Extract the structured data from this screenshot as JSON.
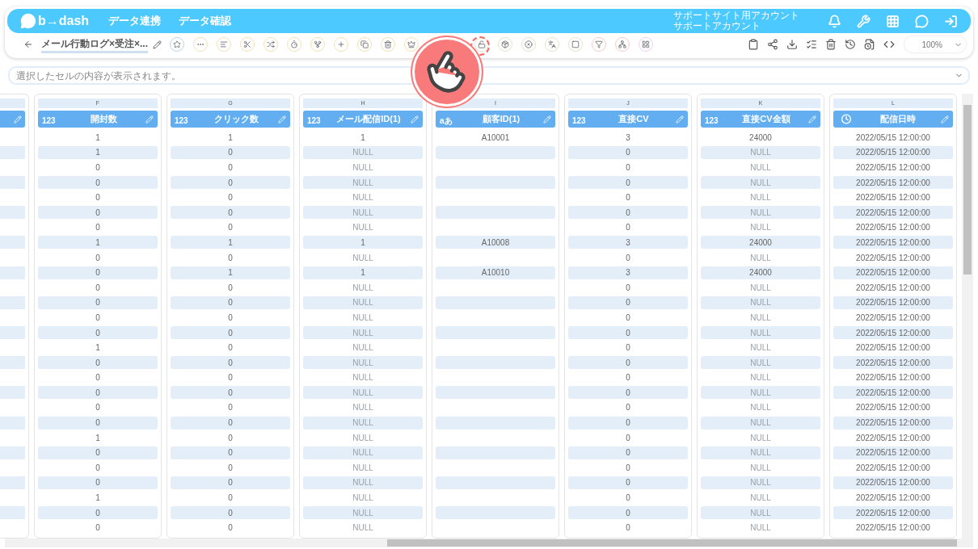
{
  "header": {
    "logo": "b→dash",
    "nav": [
      {
        "label": "データ連携"
      },
      {
        "label": "データ確認"
      }
    ],
    "account": {
      "site": "サポートサイト用アカウント",
      "user": "サポートアカウント"
    }
  },
  "toolbar": {
    "title": "メール行動ログ×受注×...",
    "zoom": "100%"
  },
  "cell_view": {
    "placeholder": "選択したセルの内容が表示されます。"
  },
  "columns": [
    {
      "letter": "F",
      "name": "開封数",
      "kind": "number",
      "type_label": "123"
    },
    {
      "letter": "G",
      "name": "クリック数",
      "kind": "number",
      "type_label": "123"
    },
    {
      "letter": "H",
      "name": "メール配信ID(1)",
      "kind": "number",
      "type_label": "123"
    },
    {
      "letter": "I",
      "name": "顧客ID(1)",
      "kind": "text",
      "type_label": "aあ"
    },
    {
      "letter": "J",
      "name": "直接CV",
      "kind": "number",
      "type_label": "123"
    },
    {
      "letter": "K",
      "name": "直接CV金額",
      "kind": "number",
      "type_label": "123"
    },
    {
      "letter": "L",
      "name": "配信日時",
      "kind": "datetime"
    }
  ],
  "rows": [
    [
      "1",
      "1",
      "1",
      "A10001",
      "3",
      "24000",
      "2022/05/15 12:00:00"
    ],
    [
      "1",
      "0",
      {
        "kind": "null",
        "text": "NULL"
      },
      null,
      "0",
      {
        "kind": "null",
        "text": "NULL"
      },
      "2022/05/15 12:00:00"
    ],
    [
      "0",
      "0",
      {
        "kind": "null",
        "text": "NULL"
      },
      null,
      "0",
      {
        "kind": "null",
        "text": "NULL"
      },
      "2022/05/15 12:00:00"
    ],
    [
      "0",
      "0",
      {
        "kind": "null",
        "text": "NULL"
      },
      null,
      "0",
      {
        "kind": "null",
        "text": "NULL"
      },
      "2022/05/15 12:00:00"
    ],
    [
      "0",
      "0",
      {
        "kind": "null",
        "text": "NULL"
      },
      null,
      "0",
      {
        "kind": "null",
        "text": "NULL"
      },
      "2022/05/15 12:00:00"
    ],
    [
      "0",
      "0",
      {
        "kind": "null",
        "text": "NULL"
      },
      null,
      "0",
      {
        "kind": "null",
        "text": "NULL"
      },
      "2022/05/15 12:00:00"
    ],
    [
      "0",
      "0",
      {
        "kind": "null",
        "text": "NULL"
      },
      null,
      "0",
      {
        "kind": "null",
        "text": "NULL"
      },
      "2022/05/15 12:00:00"
    ],
    [
      "1",
      "1",
      "1",
      "A10008",
      "3",
      "24000",
      "2022/05/15 12:00:00"
    ],
    [
      "0",
      "0",
      {
        "kind": "null",
        "text": "NULL"
      },
      null,
      "0",
      {
        "kind": "null",
        "text": "NULL"
      },
      "2022/05/15 12:00:00"
    ],
    [
      "0",
      "1",
      "1",
      "A10010",
      "3",
      "24000",
      "2022/05/15 12:00:00"
    ],
    [
      "0",
      "0",
      {
        "kind": "null",
        "text": "NULL"
      },
      null,
      "0",
      {
        "kind": "null",
        "text": "NULL"
      },
      "2022/05/15 12:00:00"
    ],
    [
      "0",
      "0",
      {
        "kind": "null",
        "text": "NULL"
      },
      null,
      "0",
      {
        "kind": "null",
        "text": "NULL"
      },
      "2022/05/15 12:00:00"
    ],
    [
      "0",
      "0",
      {
        "kind": "null",
        "text": "NULL"
      },
      null,
      "0",
      {
        "kind": "null",
        "text": "NULL"
      },
      "2022/05/15 12:00:00"
    ],
    [
      "0",
      "0",
      {
        "kind": "null",
        "text": "NULL"
      },
      null,
      "0",
      {
        "kind": "null",
        "text": "NULL"
      },
      "2022/05/15 12:00:00"
    ],
    [
      "1",
      "0",
      {
        "kind": "null",
        "text": "NULL"
      },
      null,
      "0",
      {
        "kind": "null",
        "text": "NULL"
      },
      "2022/05/15 12:00:00"
    ],
    [
      "0",
      "0",
      {
        "kind": "null",
        "text": "NULL"
      },
      null,
      "0",
      {
        "kind": "null",
        "text": "NULL"
      },
      "2022/05/15 12:00:00"
    ],
    [
      "0",
      "0",
      {
        "kind": "null",
        "text": "NULL"
      },
      null,
      "0",
      {
        "kind": "null",
        "text": "NULL"
      },
      "2022/05/15 12:00:00"
    ],
    [
      "0",
      "0",
      {
        "kind": "null",
        "text": "NULL"
      },
      null,
      "0",
      {
        "kind": "null",
        "text": "NULL"
      },
      "2022/05/15 12:00:00"
    ],
    [
      "0",
      "0",
      {
        "kind": "null",
        "text": "NULL"
      },
      null,
      "0",
      {
        "kind": "null",
        "text": "NULL"
      },
      "2022/05/15 12:00:00"
    ],
    [
      "0",
      "0",
      {
        "kind": "null",
        "text": "NULL"
      },
      null,
      "0",
      {
        "kind": "null",
        "text": "NULL"
      },
      "2022/05/15 12:00:00"
    ],
    [
      "1",
      "0",
      {
        "kind": "null",
        "text": "NULL"
      },
      null,
      "0",
      {
        "kind": "null",
        "text": "NULL"
      },
      "2022/05/15 12:00:00"
    ],
    [
      "0",
      "0",
      {
        "kind": "null",
        "text": "NULL"
      },
      null,
      "0",
      {
        "kind": "null",
        "text": "NULL"
      },
      "2022/05/15 12:00:00"
    ],
    [
      "0",
      "0",
      {
        "kind": "null",
        "text": "NULL"
      },
      null,
      "0",
      {
        "kind": "null",
        "text": "NULL"
      },
      "2022/05/15 12:00:00"
    ],
    [
      "0",
      "0",
      {
        "kind": "null",
        "text": "NULL"
      },
      null,
      "0",
      {
        "kind": "null",
        "text": "NULL"
      },
      "2022/05/15 12:00:00"
    ],
    [
      "1",
      "0",
      {
        "kind": "null",
        "text": "NULL"
      },
      null,
      "0",
      {
        "kind": "null",
        "text": "NULL"
      },
      "2022/05/15 12:00:00"
    ],
    [
      "0",
      "0",
      {
        "kind": "null",
        "text": "NULL"
      },
      null,
      "0",
      {
        "kind": "null",
        "text": "NULL"
      },
      "2022/05/15 12:00:00"
    ],
    [
      "0",
      "0",
      {
        "kind": "null",
        "text": "NULL"
      },
      null,
      "0",
      {
        "kind": "null",
        "text": "NULL"
      },
      "2022/05/15 12:00:00"
    ]
  ]
}
